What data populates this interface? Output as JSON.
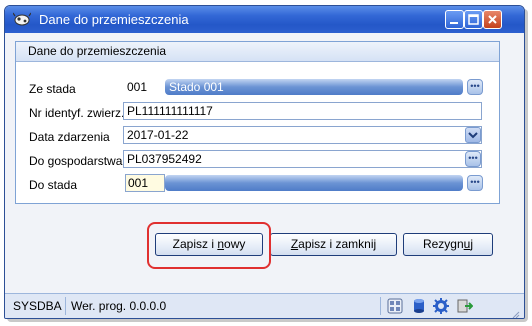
{
  "window": {
    "title": "Dane do przemieszczenia"
  },
  "panel": {
    "header": "Dane do przemieszczenia"
  },
  "form": {
    "ze_stada": {
      "label": "Ze stada",
      "code": "001",
      "name": "Stado 001"
    },
    "nr_identyf": {
      "label": "Nr identyf. zwierz.",
      "value": "PL111111111117"
    },
    "data_zdarzenia": {
      "label": "Data zdarzenia",
      "value": "2017-01-22"
    },
    "do_gospodarstwa": {
      "label": "Do gospodarstwa",
      "value": "PL037952492"
    },
    "do_stada": {
      "label": "Do stada",
      "code": "001",
      "name": ""
    }
  },
  "buttons": {
    "save_new_prefix": "Zapisz i ",
    "save_new_underlined": "n",
    "save_new_suffix": "owy",
    "save_close_prefix": "",
    "save_close_underlined": "Z",
    "save_close_suffix": "apisz i zamknij",
    "cancel_prefix": "Rezygn",
    "cancel_underlined": "u",
    "cancel_suffix": "j"
  },
  "statusbar": {
    "user": "SYSDBA",
    "version": "Wer. prog. 0.0.0.0",
    "icons": [
      "calculator-icon",
      "database-icon",
      "settings-gear-icon",
      "exit-icon"
    ]
  },
  "colors": {
    "titlebar": "#2457c8",
    "highlight": "#e03030",
    "field_border": "#8aa5cf"
  }
}
